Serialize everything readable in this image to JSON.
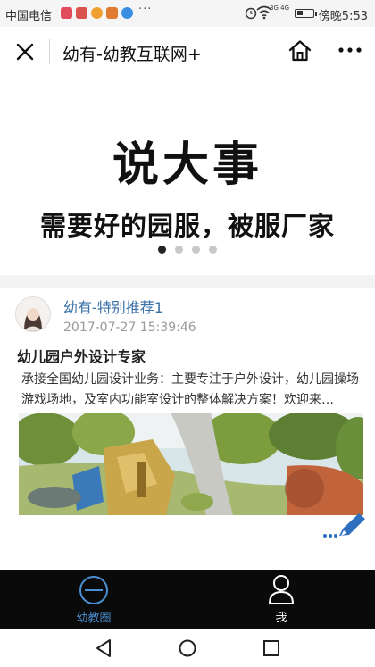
{
  "status_bar": {
    "carrier": "中国电信",
    "more": "···",
    "network": "3G 4G",
    "time": "傍晚5:53"
  },
  "title_bar": {
    "title": "幼有-幼教互联网+"
  },
  "banner": {
    "headline": "说大事",
    "subline": "需要好的园服，被服厂家",
    "slides": 4,
    "active_slide": 1
  },
  "post": {
    "author": "幼有-特别推荐1",
    "time": "2017-07-27 15:39:46",
    "title": "幼儿园户外设计专家",
    "body": "承接全国幼儿园设计业务：主要专注于户外设计，幼儿园操场游戏场地，及室内功能室设计的整体解决方案！欢迎来…"
  },
  "tabs": [
    {
      "label": "幼教圈",
      "icon": "circle-line-icon",
      "active": true
    },
    {
      "label": "我",
      "icon": "person-icon",
      "active": false
    }
  ],
  "colors": {
    "link_blue": "#3b72a8",
    "tab_active": "#4a8fd4",
    "tab_bar": "#0a0a0a"
  }
}
